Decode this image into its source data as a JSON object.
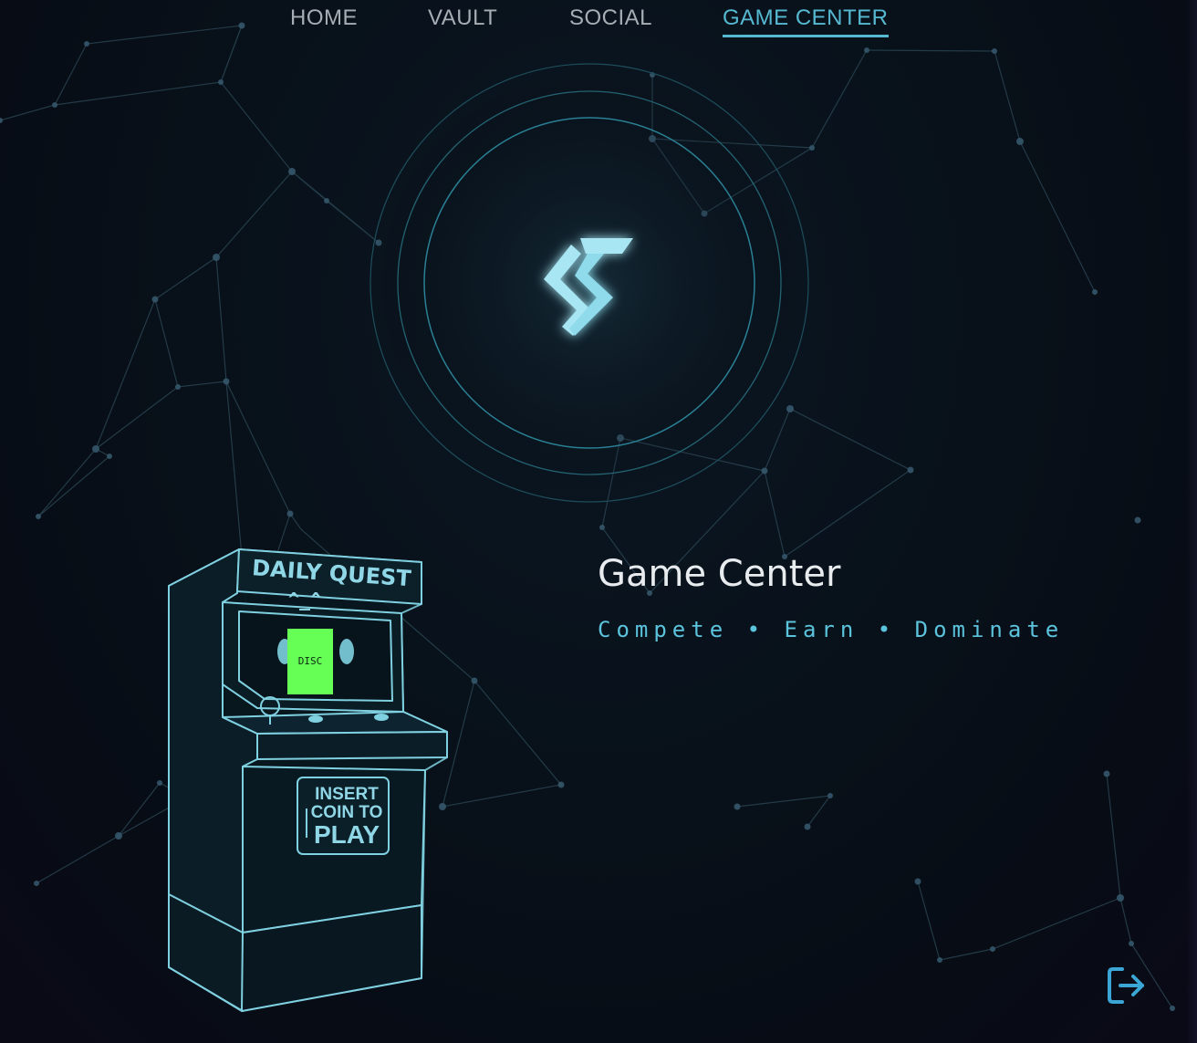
{
  "nav": {
    "items": [
      {
        "label": "HOME"
      },
      {
        "label": "VAULT"
      },
      {
        "label": "SOCIAL"
      },
      {
        "label": "GAME CENTER"
      }
    ],
    "active": "GAME CENTER"
  },
  "hero": {
    "logo_icon": "brand-s-logo-icon",
    "title": "Game Center",
    "tagline": "Compete • Earn • Dominate"
  },
  "arcade": {
    "marquee": "DAILY QUEST",
    "face": "^_^",
    "screen_label": "DISC",
    "coin_line1": "INSERT",
    "coin_line2": "COIN TO",
    "coin_line3": "PLAY"
  },
  "footer": {
    "logout_icon": "logout-icon"
  },
  "colors": {
    "accent": "#56b9d2",
    "screen_green": "#66ff55",
    "background": "#08111a"
  }
}
